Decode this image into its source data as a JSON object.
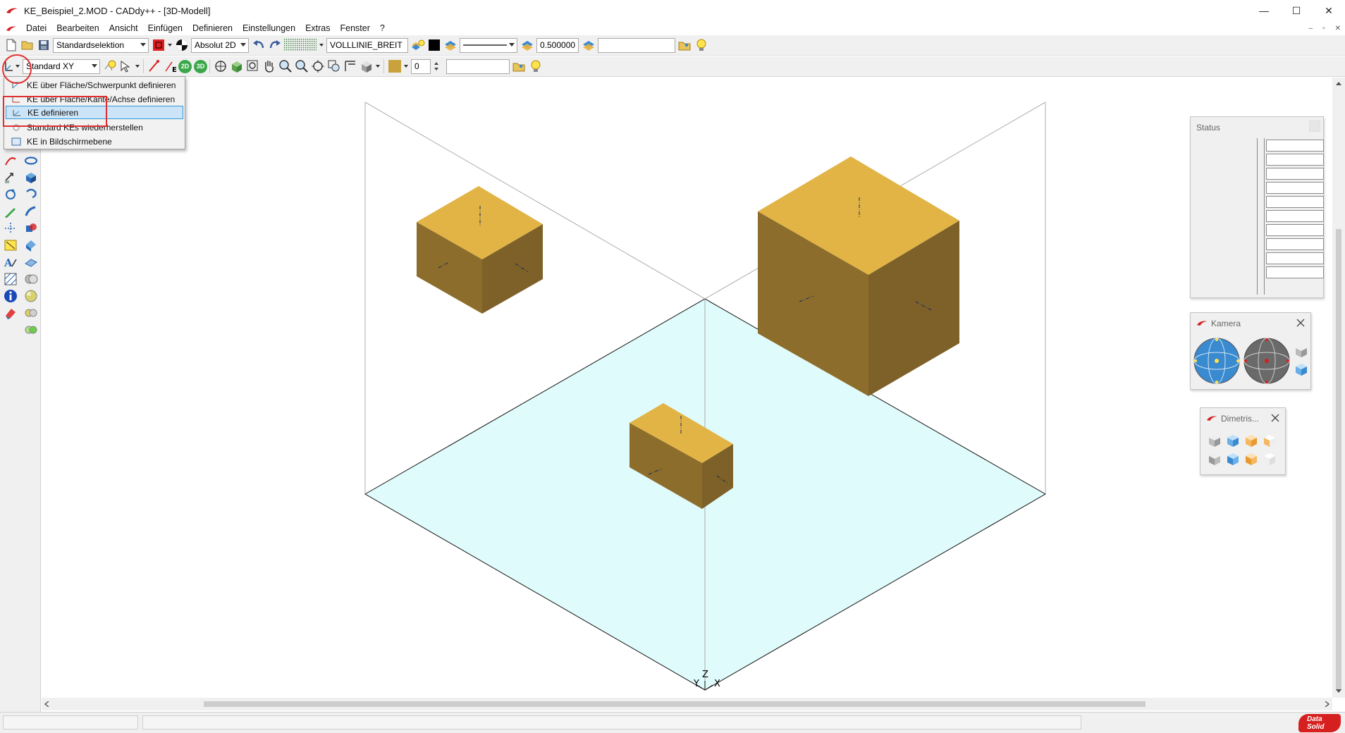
{
  "window": {
    "title": "KE_Beispiel_2.MOD  -  CADdy++ - [3D-Modell]",
    "minimize": "—",
    "maximize": "☐",
    "close": "✕"
  },
  "menu": {
    "items": [
      "Datei",
      "Bearbeiten",
      "Ansicht",
      "Einfügen",
      "Definieren",
      "Einstellungen",
      "Extras",
      "Fenster",
      "?"
    ],
    "mdi_minimize": "–",
    "mdi_restore": "▫",
    "mdi_close": "✕"
  },
  "toolbar1": {
    "selection_mode": "Standardselektion",
    "coord_mode": "Absolut 2D",
    "line_style": "VOLLLINIE_BREIT",
    "line_width": "0.500000",
    "extra_field": ""
  },
  "toolbar2": {
    "view": "Standard XY",
    "btn_2d": "2D",
    "btn_3d": "3D",
    "layer_value": "0",
    "extra_field": "",
    "edge_label": "E"
  },
  "dropdown": {
    "items": [
      "KE über Fläche/Schwerpunkt definieren",
      "KE über Fläche/Kante/Achse definieren",
      "KE definieren",
      "Standard KEs wiederherstellen",
      "KE in Bildschirmebene"
    ],
    "selected_index": 2
  },
  "panels": {
    "status": {
      "title": "Status"
    },
    "kamera": {
      "title": "Kamera"
    },
    "dimetrisch": {
      "title": "Dimetris..."
    }
  },
  "axes": {
    "x": "X",
    "y": "Y",
    "z": "Z"
  },
  "brand": {
    "line1": "Data",
    "line2": "Solid"
  },
  "colors": {
    "box_top": "#e1b445",
    "box_left": "#8d6d2c",
    "box_right": "#7d6128",
    "ground": "#e0fbfb",
    "accent_red": "#e03030",
    "selection": "#cce4f7"
  }
}
